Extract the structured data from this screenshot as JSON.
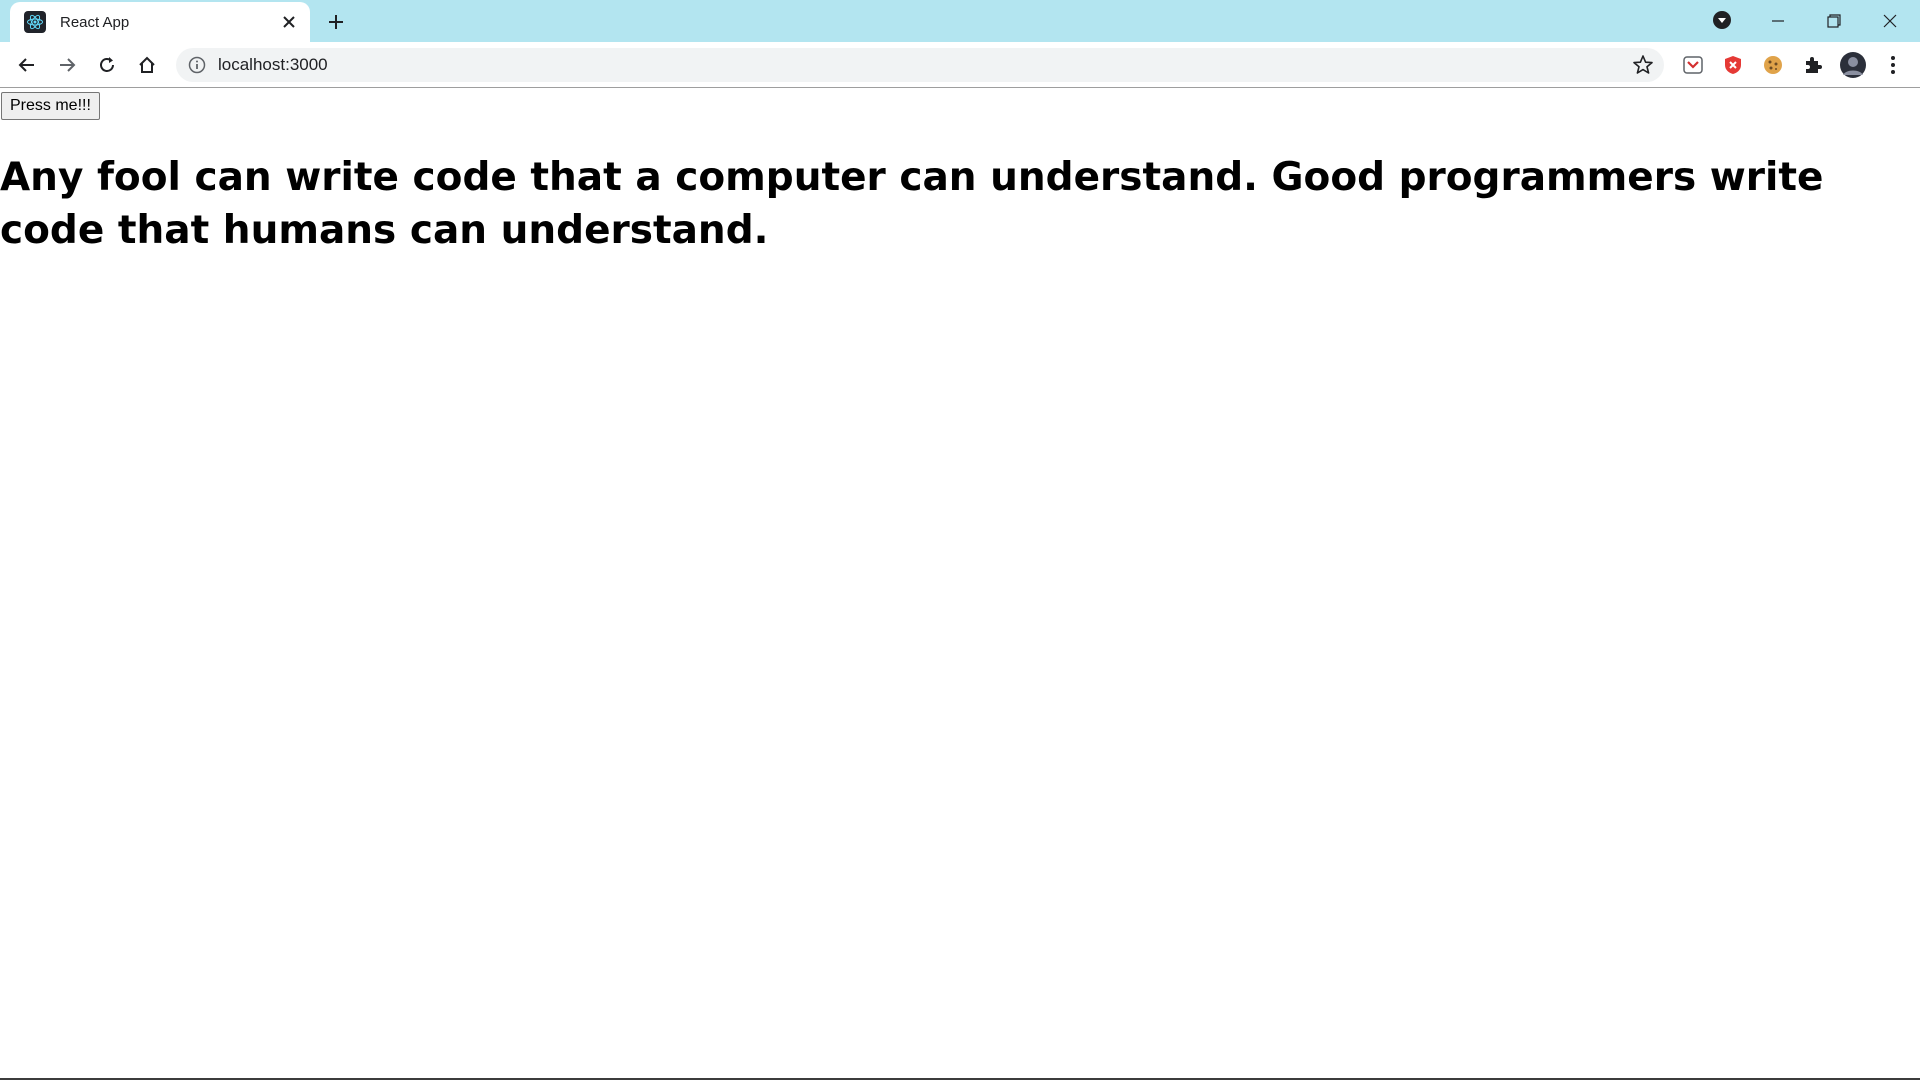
{
  "browser": {
    "tab_title": "React App",
    "url": "localhost:3000",
    "theme_color": "#b3e5f0"
  },
  "icons": {
    "favicon": "react-logo-icon",
    "tab_close": "close-icon",
    "new_tab": "plus-icon",
    "profile_dropdown": "chevron-down-circle-icon",
    "minimize": "minimize-icon",
    "restore": "restore-icon",
    "close_window": "close-icon",
    "back": "arrow-left-icon",
    "forward": "arrow-right-icon",
    "reload": "reload-icon",
    "home": "home-icon",
    "site_info": "info-icon",
    "bookmark": "star-icon",
    "extensions": [
      "pocket-icon",
      "shield-icon",
      "cookie-icon",
      "puzzle-icon"
    ],
    "avatar": "avatar-icon",
    "menu": "kebab-menu-icon"
  },
  "page": {
    "button_label": "Press me!!!",
    "quote": "Any fool can write code that a computer can understand. Good programmers write code that humans can understand."
  }
}
